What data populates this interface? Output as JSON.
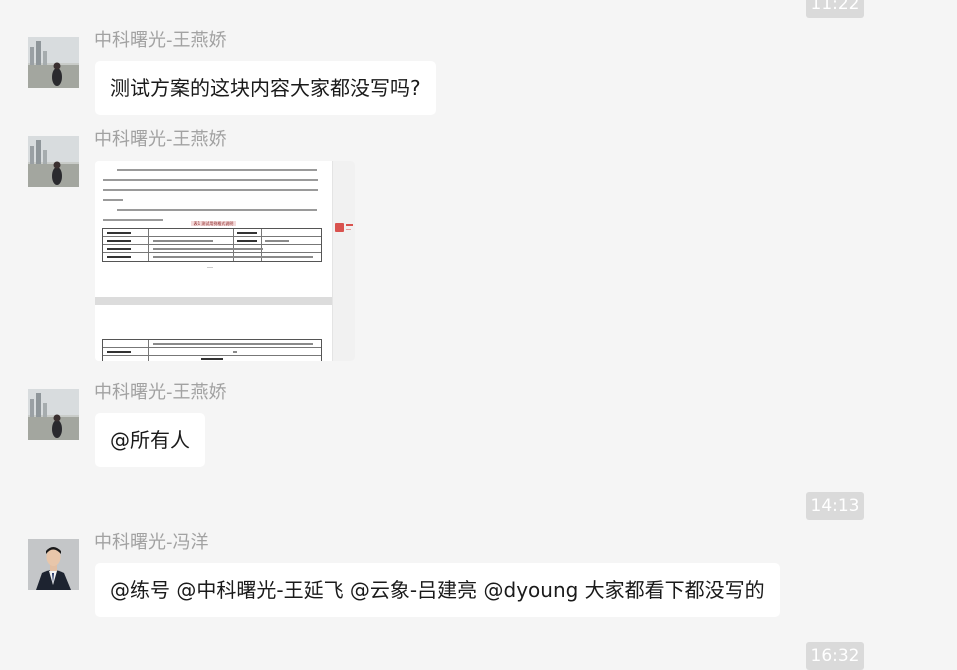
{
  "timestamps": [
    "11:22",
    "14:13",
    "16:32"
  ],
  "messages": [
    {
      "sender": "中科曙光-王燕娇",
      "text": "测试方案的这块内容大家都没写吗?"
    },
    {
      "sender": "中科曙光-王燕娇",
      "type": "image",
      "image_caption": "表1 测试用例格式说明"
    },
    {
      "sender": "中科曙光-王燕娇",
      "text": "@所有人"
    },
    {
      "sender": "中科曙光-冯洋",
      "text": "@练号 @中科曙光-王延飞 @云象-吕建亮 @dyoung 大家都看下都没写的"
    }
  ],
  "colors": {
    "background": "#f5f5f5",
    "bubble": "#ffffff",
    "sender_name": "#a2a2a2",
    "timestamp_bg": "#dadada"
  }
}
